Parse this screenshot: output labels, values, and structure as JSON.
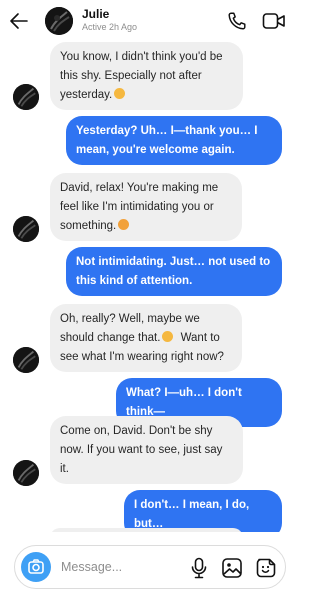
{
  "header": {
    "contact_name": "Julie",
    "status": "Active 2h Ago",
    "back_icon": "arrow-left-icon",
    "call_icon": "phone-icon",
    "video_icon": "video-camera-icon"
  },
  "messages": [
    {
      "from": "them",
      "text": "You know, I didn't think you'd be this shy. Especially not after yesterday.",
      "emoji": "smirk-emoji"
    },
    {
      "from": "me",
      "text": "Yesterday? Uh… I—thank you… I mean, you're welcome again."
    },
    {
      "from": "them",
      "text": "David, relax! You're making me feel like I'm intimidating you or something.",
      "emoji": "laughing-emoji"
    },
    {
      "from": "me",
      "text": "Not intimidating. Just… not used to this kind of attention."
    },
    {
      "from": "them",
      "text": "Oh, really? Well, maybe we should change that.",
      "emoji": "wink-emoji",
      "text_after": "Want to see what I'm wearing right now?"
    },
    {
      "from": "me",
      "text": "What? I—uh… I don't think—"
    },
    {
      "from": "them",
      "text": "Come on, David. Don't be shy now. If you want to see, just say it."
    },
    {
      "from": "me",
      "text": "I don't… I mean, I do, but…"
    }
  ],
  "composer": {
    "placeholder": "Message...",
    "camera_icon": "camera-icon",
    "mic_icon": "microphone-icon",
    "gallery_icon": "image-icon",
    "sticker_icon": "sticker-icon"
  },
  "colors": {
    "outgoing_bubble": "#2f74f2",
    "incoming_bubble": "#efefef",
    "camera_button": "#3fa0f5"
  }
}
